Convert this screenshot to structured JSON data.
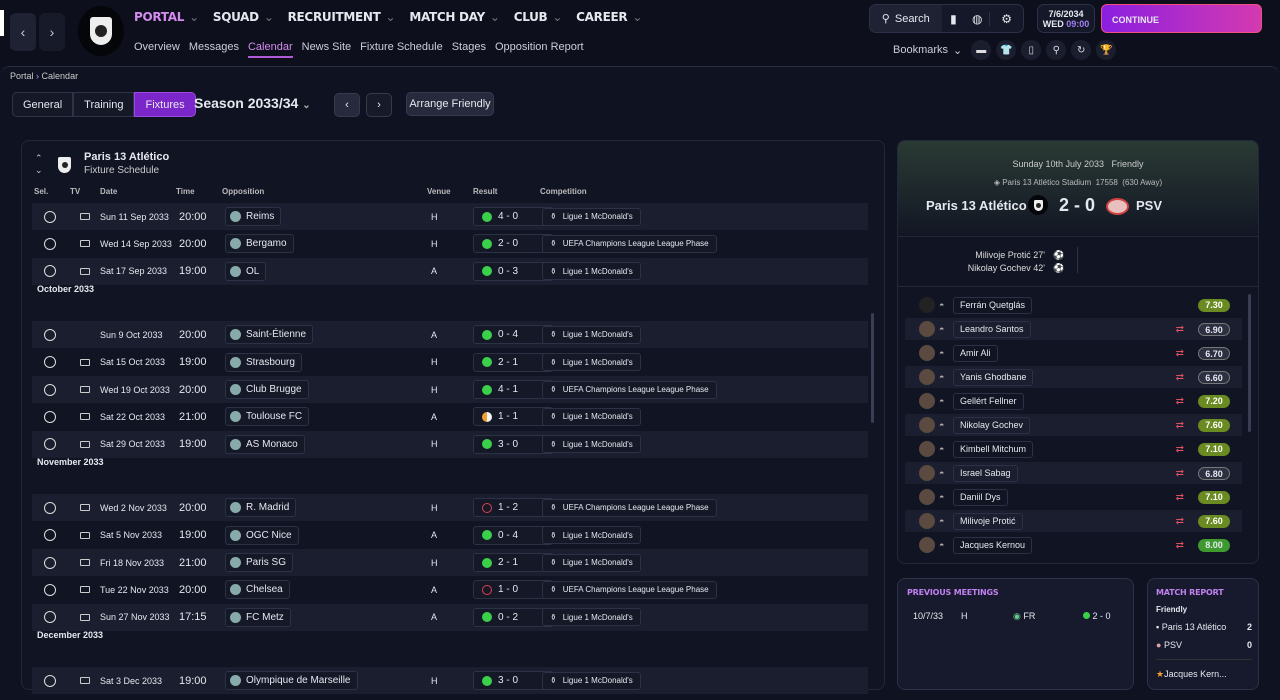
{
  "nav": {
    "primary": [
      {
        "label": "PORTAL",
        "active": true
      },
      {
        "label": "SQUAD"
      },
      {
        "label": "RECRUITMENT"
      },
      {
        "label": "MATCH DAY"
      },
      {
        "label": "CLUB"
      },
      {
        "label": "CAREER"
      }
    ],
    "secondary": [
      {
        "label": "Overview"
      },
      {
        "label": "Messages"
      },
      {
        "label": "Calendar",
        "active": true
      },
      {
        "label": "News Site"
      },
      {
        "label": "Fixture Schedule"
      },
      {
        "label": "Stages"
      },
      {
        "label": "Opposition Report"
      }
    ]
  },
  "topbar": {
    "search": "Search",
    "date": "7/6/2034",
    "day": "WED",
    "time": "09:00",
    "continue": "CONTINUE",
    "bookmarks": "Bookmarks",
    "accent": "#b05ad8"
  },
  "breadcrumb": [
    "Portal",
    "Calendar"
  ],
  "tabs": [
    {
      "label": "General"
    },
    {
      "label": "Training"
    },
    {
      "label": "Fixtures",
      "active": true
    }
  ],
  "season": "Season 2033/34",
  "arrange": "Arrange Friendly",
  "schedule": {
    "club": "Paris 13 Atlético",
    "subtitle": "Fixture Schedule",
    "columns": [
      "Sel.",
      "TV",
      "Date",
      "Time",
      "Opposition",
      "Venue",
      "Result",
      "Competition"
    ],
    "groups": [
      {
        "month": "",
        "rows": [
          {
            "tv": true,
            "date": "Sun 11 Sep 2033",
            "time": "20:00",
            "opp": "Reims",
            "venue": "H",
            "result": "4 - 0",
            "status": "win",
            "comp": "Ligue 1 McDonald's"
          },
          {
            "tv": true,
            "date": "Wed 14 Sep 2033",
            "time": "20:00",
            "opp": "Bergamo",
            "venue": "H",
            "result": "2 - 0",
            "status": "win",
            "comp": "UEFA Champions League League Phase"
          },
          {
            "tv": true,
            "date": "Sat 17 Sep 2033",
            "time": "19:00",
            "opp": "OL",
            "venue": "A",
            "result": "0 - 3",
            "status": "win",
            "comp": "Ligue 1 McDonald's"
          }
        ]
      },
      {
        "month": "October 2033",
        "rows": [
          {
            "tv": false,
            "date": "Sun 9 Oct 2033",
            "time": "20:00",
            "opp": "Saint-Étienne",
            "venue": "A",
            "result": "0 - 4",
            "status": "win",
            "comp": "Ligue 1 McDonald's"
          },
          {
            "tv": true,
            "date": "Sat 15 Oct 2033",
            "time": "19:00",
            "opp": "Strasbourg",
            "venue": "H",
            "result": "2 - 1",
            "status": "win",
            "comp": "Ligue 1 McDonald's"
          },
          {
            "tv": true,
            "date": "Wed 19 Oct 2033",
            "time": "20:00",
            "opp": "Club Brugge",
            "venue": "H",
            "result": "4 - 1",
            "status": "win",
            "comp": "UEFA Champions League League Phase"
          },
          {
            "tv": true,
            "date": "Sat 22 Oct 2033",
            "time": "21:00",
            "opp": "Toulouse FC",
            "venue": "A",
            "result": "1 - 1",
            "status": "draw",
            "comp": "Ligue 1 McDonald's"
          },
          {
            "tv": true,
            "date": "Sat 29 Oct 2033",
            "time": "19:00",
            "opp": "AS Monaco",
            "venue": "H",
            "result": "3 - 0",
            "status": "win",
            "comp": "Ligue 1 McDonald's"
          }
        ]
      },
      {
        "month": "November 2033",
        "rows": [
          {
            "tv": true,
            "date": "Wed 2 Nov 2033",
            "time": "20:00",
            "opp": "R. Madrid",
            "venue": "H",
            "result": "1 - 2",
            "status": "loss",
            "comp": "UEFA Champions League League Phase"
          },
          {
            "tv": true,
            "date": "Sat 5 Nov 2033",
            "time": "19:00",
            "opp": "OGC Nice",
            "venue": "A",
            "result": "0 - 4",
            "status": "win",
            "comp": "Ligue 1 McDonald's"
          },
          {
            "tv": true,
            "date": "Fri 18 Nov 2033",
            "time": "21:00",
            "opp": "Paris SG",
            "venue": "H",
            "result": "2 - 1",
            "status": "win",
            "comp": "Ligue 1 McDonald's"
          },
          {
            "tv": true,
            "date": "Tue 22 Nov 2033",
            "time": "20:00",
            "opp": "Chelsea",
            "venue": "A",
            "result": "1 - 0",
            "status": "loss",
            "comp": "UEFA Champions League League Phase"
          },
          {
            "tv": true,
            "date": "Sun 27 Nov 2033",
            "time": "17:15",
            "opp": "FC Metz",
            "venue": "A",
            "result": "0 - 2",
            "status": "win",
            "comp": "Ligue 1 McDonald's"
          }
        ]
      },
      {
        "month": "December 2033",
        "rows": [
          {
            "tv": true,
            "date": "Sat 3 Dec 2033",
            "time": "19:00",
            "opp": "Olympique de Marseille",
            "venue": "H",
            "result": "3 - 0",
            "status": "win",
            "comp": "Ligue 1 McDonald's"
          }
        ]
      }
    ]
  },
  "match": {
    "date": "Sunday 10th July 2033",
    "type": "Friendly",
    "stadium": "Paris 13 Atlético Stadium",
    "attendance": "17558",
    "away": "(630 Away)",
    "home": "Paris 13 Atlético",
    "score": "2 - 0",
    "opponent": "PSV",
    "scorers": [
      "Milivoje Protić 27'",
      "Nikolay Gochev 42'"
    ],
    "players": [
      {
        "name": "Ferrán Quetglás",
        "rating": "7.30",
        "sub": false,
        "tier": "g"
      },
      {
        "name": "Leandro Santos",
        "rating": "6.90",
        "sub": true,
        "tier": "n"
      },
      {
        "name": "Amir Ali",
        "rating": "6.70",
        "sub": true,
        "tier": "n"
      },
      {
        "name": "Yanis Ghodbane",
        "rating": "6.60",
        "sub": true,
        "tier": "n"
      },
      {
        "name": "Gellért Fellner",
        "rating": "7.20",
        "sub": true,
        "tier": "g"
      },
      {
        "name": "Nikolay Gochev",
        "rating": "7.60",
        "sub": true,
        "tier": "g"
      },
      {
        "name": "Kimbell Mitchum",
        "rating": "7.10",
        "sub": true,
        "tier": "g"
      },
      {
        "name": "Israel Sabag",
        "rating": "6.80",
        "sub": true,
        "tier": "n"
      },
      {
        "name": "Daniil Dys",
        "rating": "7.10",
        "sub": true,
        "tier": "g"
      },
      {
        "name": "Milivoje Protić",
        "rating": "7.60",
        "sub": true,
        "tier": "g"
      },
      {
        "name": "Jacques Kernou",
        "rating": "8.00",
        "sub": true,
        "tier": "b"
      }
    ]
  },
  "previous": {
    "title": "PREVIOUS MEETINGS",
    "rows": [
      {
        "date": "10/7/33",
        "venue": "H",
        "comp": "FR",
        "result": "2 - 0"
      }
    ]
  },
  "report": {
    "title": "MATCH REPORT",
    "type": "Friendly",
    "home": "Paris 13 Atlético",
    "home_score": "2",
    "away": "PSV",
    "away_score": "0",
    "potm": "Jacques Kern..."
  }
}
